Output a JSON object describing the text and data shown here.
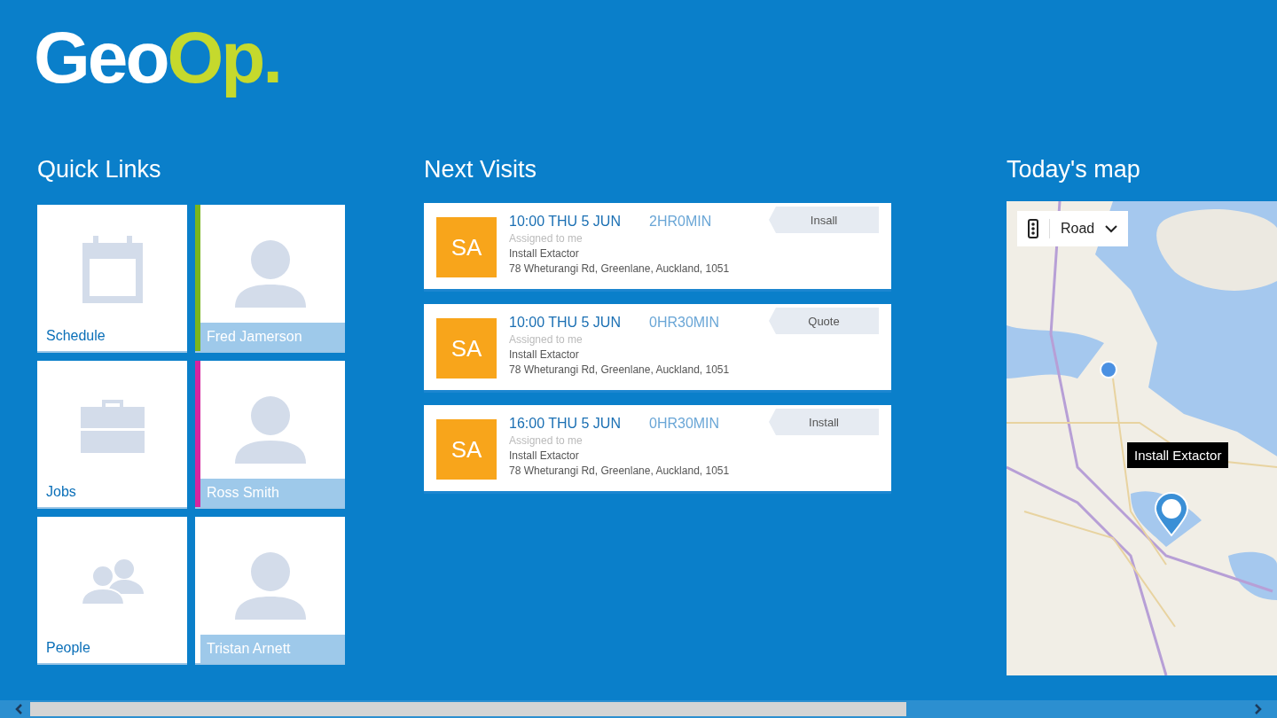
{
  "logo": {
    "part_1": "Geo",
    "part_2": "Op."
  },
  "quick_links": {
    "title": "Quick Links",
    "tiles": [
      {
        "kind": "feature",
        "label": "Schedule"
      },
      {
        "kind": "person",
        "label": "Fred Jamerson",
        "color": "#7ab51d"
      },
      {
        "kind": "feature",
        "label": "Jobs"
      },
      {
        "kind": "person",
        "label": "Ross Smith",
        "color": "#d6249f"
      },
      {
        "kind": "feature",
        "label": "People"
      },
      {
        "kind": "person",
        "label": "Tristan Arnett"
      }
    ]
  },
  "next_visits": {
    "title": "Next Visits",
    "visits": [
      {
        "initials": "SA",
        "time": "10:00  THU  5  JUN",
        "duration": "2HR0MIN",
        "assigned": "Assigned to me",
        "job": "Install Extactor",
        "address": "78 Wheturangi Rd, Greenlane, Auckland, 1051",
        "tag": "Insall"
      },
      {
        "initials": "SA",
        "time": "10:00  THU  5  JUN",
        "duration": "0HR30MIN",
        "assigned": "Assigned to me",
        "job": "Install Extactor",
        "address": "78 Wheturangi Rd, Greenlane, Auckland, 1051",
        "tag": "Quote"
      },
      {
        "initials": "SA",
        "time": "16:00  THU  5  JUN",
        "duration": "0HR30MIN",
        "assigned": "Assigned to me",
        "job": "Install Extactor",
        "address": "78 Wheturangi Rd, Greenlane, Auckland, 1051",
        "tag": "Install"
      }
    ]
  },
  "todays_map": {
    "title": "Today's map",
    "map_style": "Road",
    "tooltip": "Install Extactor"
  }
}
